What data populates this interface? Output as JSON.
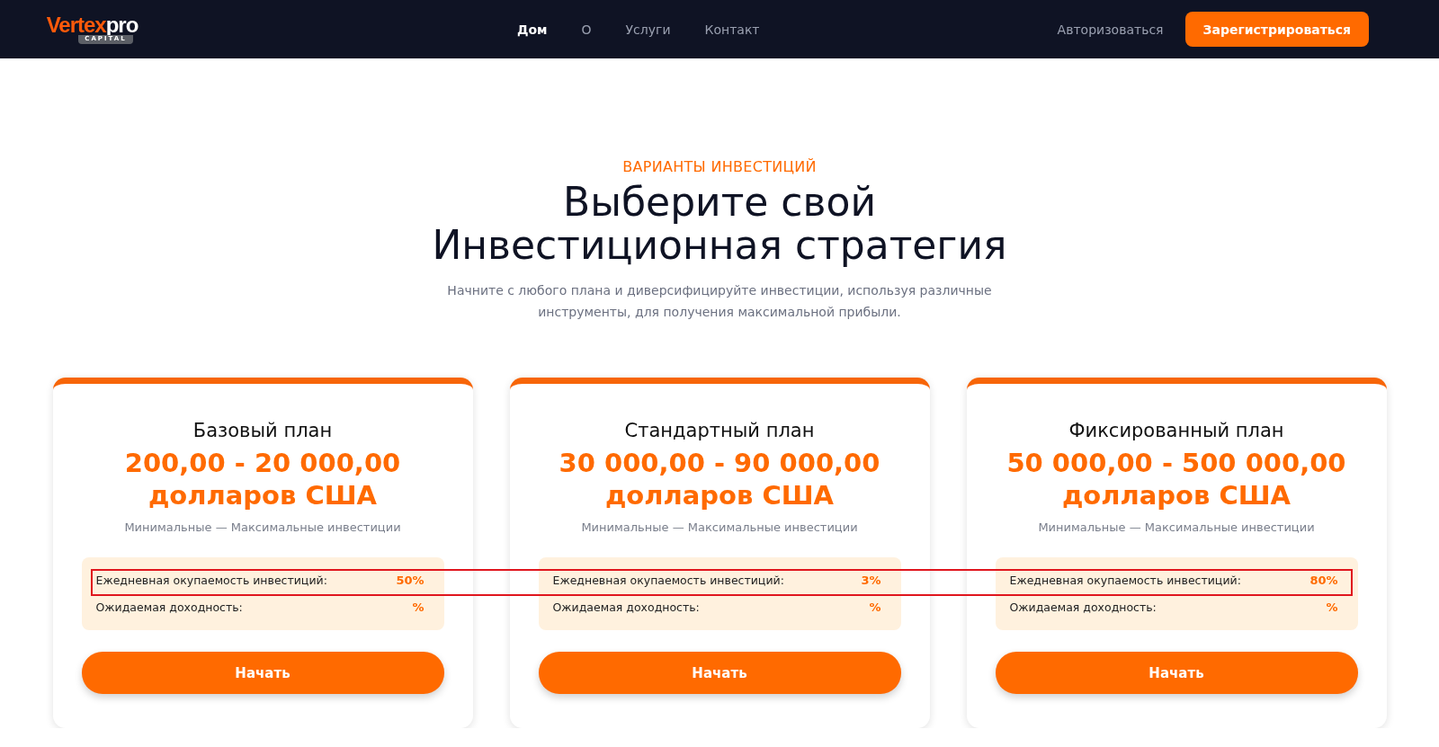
{
  "logo": {
    "word_1": "Vertex",
    "word_2": "pro",
    "tagline": "CAPITAL"
  },
  "nav": [
    {
      "label": "Дом",
      "selected": true
    },
    {
      "label": "О",
      "selected": false
    },
    {
      "label": "Услуги",
      "selected": false
    },
    {
      "label": "Контакт",
      "selected": false
    }
  ],
  "login": "Авторизоваться",
  "register": "Зарегистрироваться",
  "section": {
    "eyebrow": "ВАРИАНТЫ ИНВЕСТИЦИЙ",
    "title_lines": [
      "Выберите свой",
      "Инвестиционная стратегия"
    ],
    "subtitle": "Начните с любого плана и диверсифицируйте инвестиции, используя различные инструменты, для получения максимальной прибыли."
  },
  "plans": [
    {
      "name": "Базовый план",
      "range": "200,00 - 20 000,00",
      "currency": "долларов США",
      "range_caption": "Минимальные — Максимальные инвестиции",
      "stats": [
        {
          "label": "Ежедневная окупаемость инвестиций:",
          "value": "50%"
        },
        {
          "label": "Ожидаемая доходность:",
          "value": "%"
        }
      ],
      "button": "Начать"
    },
    {
      "name": "Стандартный план",
      "range": "30 000,00 - 90 000,00",
      "currency": "долларов США",
      "range_caption": "Минимальные — Максимальные инвестиции",
      "stats": [
        {
          "label": "Ежедневная окупаемость инвестиций:",
          "value": "3%"
        },
        {
          "label": "Ожидаемая доходность:",
          "value": "%"
        }
      ],
      "button": "Начать"
    },
    {
      "name": "Фиксированный план",
      "range": "50 000,00 - 500 000,00",
      "currency": "долларов США",
      "range_caption": "Минимальные — Максимальные инвестиции",
      "stats": [
        {
          "label": "Ежедневная окупаемость инвестиций:",
          "value": "80%"
        },
        {
          "label": "Ожидаемая доходность:",
          "value": "%"
        }
      ],
      "button": "Начать"
    }
  ]
}
